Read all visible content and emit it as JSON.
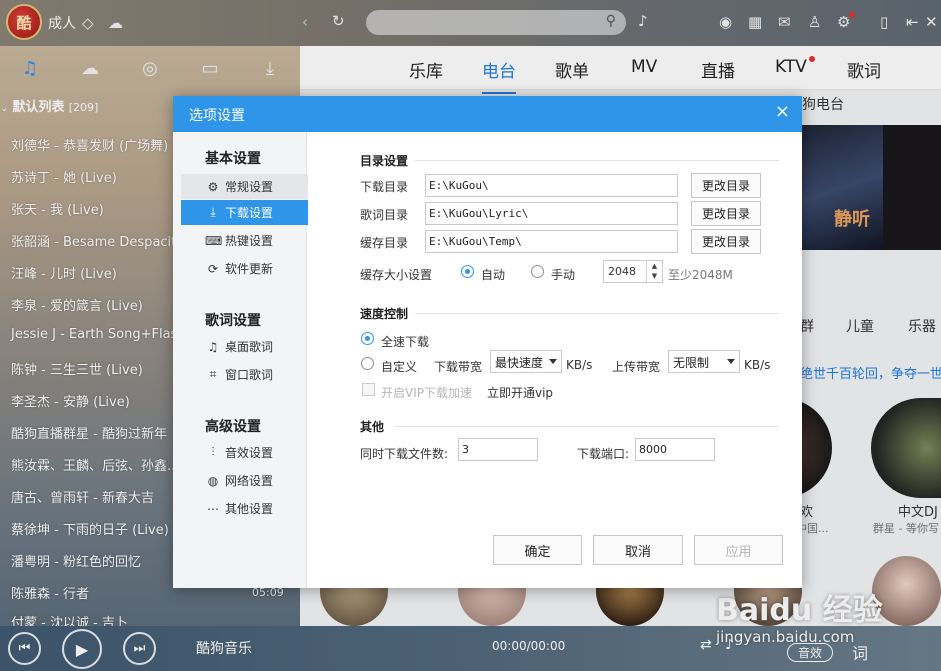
{
  "topbar": {
    "logo_text": "酷",
    "username": "成人"
  },
  "left": {
    "playlist_title": "默认列表",
    "playlist_count": "[209]",
    "songs": [
      "刘德华 - 恭喜发财 (广场舞)",
      "苏诗丁 - 她 (Live)",
      "张天 - 我 (Live)",
      "张韶涵 - Besame Despacito",
      "汪峰 - 儿时 (Live)",
      "李泉 - 爱的箴言 (Live)",
      "Jessie J - Earth Song+Flash",
      "陈钟 - 三生三世 (Live)",
      "李圣杰 - 安静 (Live)",
      "酷狗直播群星 - 酷狗过新年",
      "熊汝霖、王麟、后弦、孙鑫...",
      "唐古、曾雨轩 - 新春大吉",
      "蔡徐坤 - 下雨的日子 (Live)",
      "潘粤明 - 粉红色的回忆",
      "陈雅森 - 行者",
      "付蒙 - 沈以诚 - 吉卜"
    ],
    "last_duration": "05:09"
  },
  "nav": {
    "tabs": [
      "乐库",
      "电台",
      "歌单",
      "MV",
      "直播",
      "KTV",
      "歌词"
    ]
  },
  "right": {
    "radio_heading": "酷狗电台",
    "poster_text": "静听",
    "cat_1": "群",
    "cat_2": "儿童",
    "cat_3": "乐器",
    "banner_text": "绝世千百轮回，争夺一世",
    "item_a_title": "欢",
    "item_a_sub": "中国...",
    "item_b_title": "中文DJ",
    "item_b_sub": "群星 - 等你写"
  },
  "player": {
    "brand": "酷狗音乐",
    "time": "00:00/00:00",
    "sfx": "音效",
    "lyric": "词"
  },
  "watermark": {
    "line1": "Baidu 经验",
    "line2": "jingyan.baidu.com"
  },
  "dialog": {
    "title": "选项设置",
    "close": "×",
    "sidebar": {
      "basic_title": "基本设置",
      "basic_items": [
        "常规设置",
        "下载设置",
        "热键设置",
        "软件更新"
      ],
      "lyric_title": "歌词设置",
      "lyric_items": [
        "桌面歌词",
        "窗口歌词"
      ],
      "adv_title": "高级设置",
      "adv_items": [
        "音效设置",
        "网络设置",
        "其他设置"
      ]
    },
    "dirs": {
      "group": "目录设置",
      "download_label": "下载目录",
      "download_path": "E:\\KuGou\\",
      "lyric_label": "歌词目录",
      "lyric_path": "E:\\KuGou\\Lyric\\",
      "cache_label": "缓存目录",
      "cache_path": "E:\\KuGou\\Temp\\",
      "change_btn": "更改目录",
      "cache_size_label": "缓存大小设置",
      "auto_label": "自动",
      "manual_label": "手动",
      "cache_size_value": "2048",
      "cache_hint": "至少2048M"
    },
    "speed": {
      "group": "速度控制",
      "full_speed": "全速下载",
      "custom": "自定义",
      "down_label": "下载带宽",
      "down_value": "最快速度",
      "down_unit": "KB/s",
      "up_label": "上传带宽",
      "up_value": "无限制",
      "up_unit": "KB/s",
      "vip_accel": "开启VIP下载加速",
      "vip_link": "立即开通vip"
    },
    "other": {
      "group": "其他",
      "concurrent_label": "同时下载文件数:",
      "concurrent_value": "3",
      "port_label": "下载端口:",
      "port_value": "8000"
    },
    "buttons": {
      "ok": "确定",
      "cancel": "取消",
      "apply": "应用"
    }
  }
}
